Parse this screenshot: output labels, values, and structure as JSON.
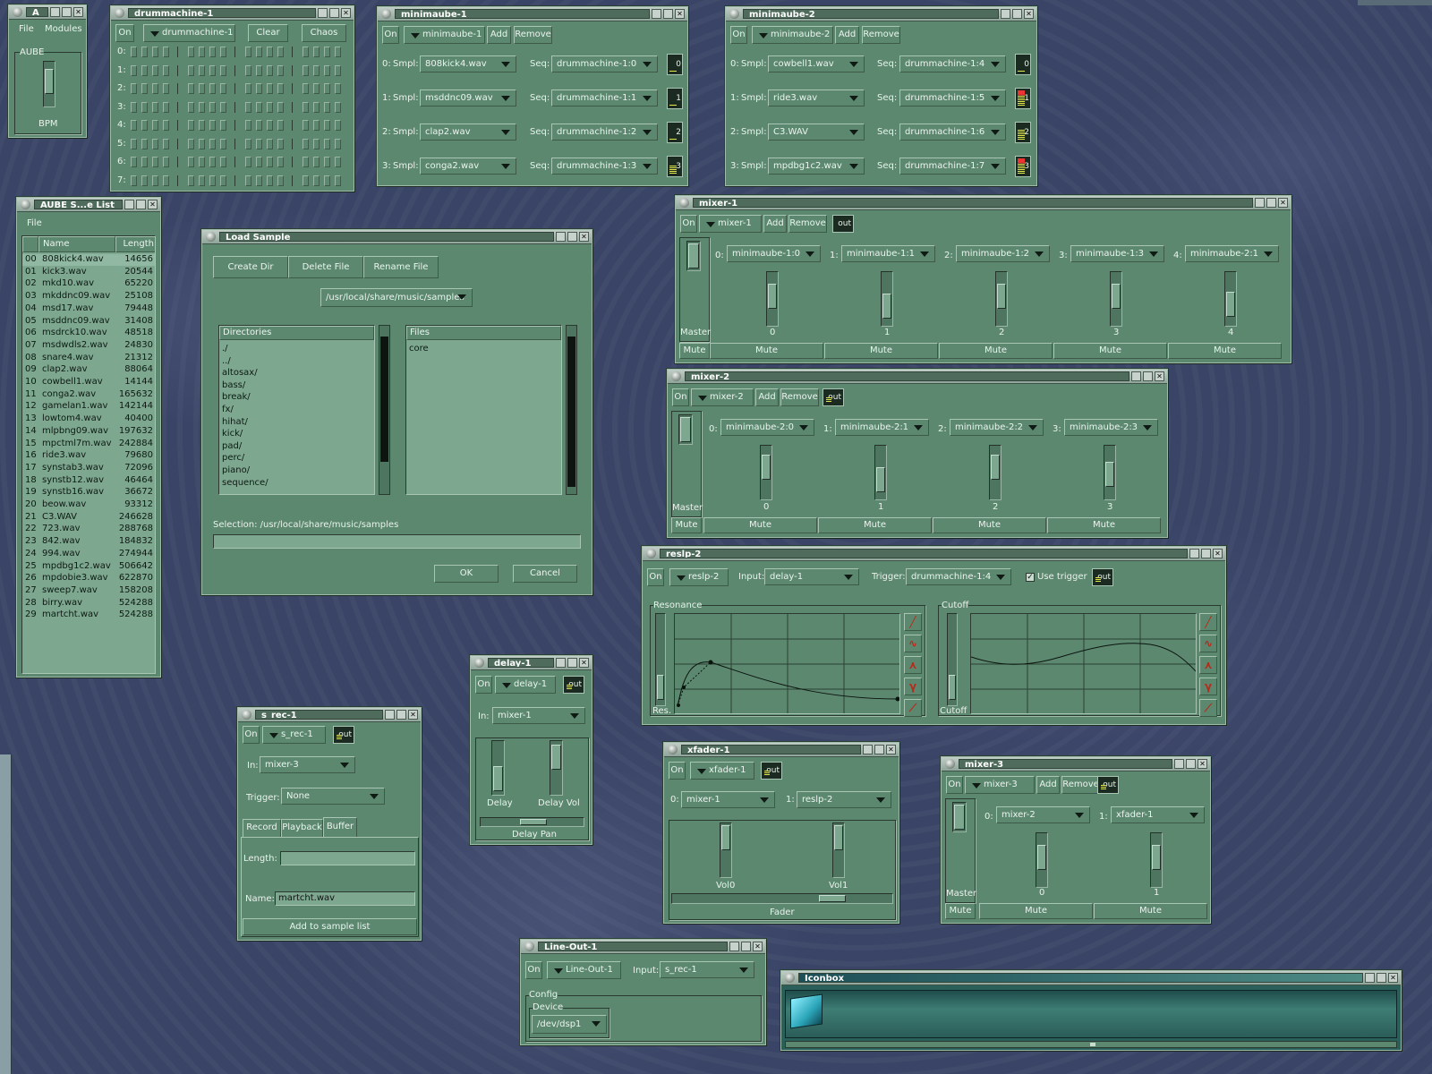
{
  "aube_main": {
    "title": "A",
    "menu_file": "File",
    "menu_modules": "Modules",
    "frame": "AUBE",
    "bpm": "BPM"
  },
  "drummachine": {
    "title": "drummachine-1",
    "on": "On",
    "module": "drummachine-1",
    "clear": "Clear",
    "chaos": "Chaos",
    "rows": [
      "0:",
      "1:",
      "2:",
      "3:",
      "4:",
      "5:",
      "6:",
      "7:"
    ]
  },
  "minimaube1": {
    "title": "minimaube-1",
    "on": "On",
    "module": "minimaube-1",
    "add": "Add",
    "remove": "Remove",
    "smpl": "Smpl:",
    "seq": "Seq:",
    "rows": [
      {
        "idx": "0:",
        "sample": "808kick4.wav",
        "seq": "drummachine-1:0",
        "meter": "0",
        "level": 0.1
      },
      {
        "idx": "1:",
        "sample": "msddnc09.wav",
        "seq": "drummachine-1:1",
        "meter": "1",
        "level": 0.1
      },
      {
        "idx": "2:",
        "sample": "clap2.wav",
        "seq": "drummachine-1:2",
        "meter": "2",
        "level": 0.1
      },
      {
        "idx": "3:",
        "sample": "conga2.wav",
        "seq": "drummachine-1:3",
        "meter": "3",
        "level": 0.5
      }
    ]
  },
  "minimaube2": {
    "title": "minimaube-2",
    "on": "On",
    "module": "minimaube-2",
    "add": "Add",
    "remove": "Remove",
    "smpl": "Smpl:",
    "seq": "Seq:",
    "rows": [
      {
        "idx": "0:",
        "sample": "cowbell1.wav",
        "seq": "drummachine-1:4",
        "meter": "0",
        "level": 0.1
      },
      {
        "idx": "1:",
        "sample": "ride3.wav",
        "seq": "drummachine-1:5",
        "meter": "1",
        "level": 0.9
      },
      {
        "idx": "2:",
        "sample": "C3.WAV",
        "seq": "drummachine-1:6",
        "meter": "2",
        "level": 0.6
      },
      {
        "idx": "3:",
        "sample": "mpdbg1c2.wav",
        "seq": "drummachine-1:7",
        "meter": "3",
        "level": 0.9
      }
    ]
  },
  "samplelist": {
    "title": "AUBE S...e List",
    "menu_file": "File",
    "col_name": "Name",
    "col_length": "Length",
    "rows": [
      [
        "00",
        "808kick4.wav",
        "14656"
      ],
      [
        "01",
        "kick3.wav",
        "20544"
      ],
      [
        "02",
        "mkd10.wav",
        "65220"
      ],
      [
        "03",
        "mkddnc09.wav",
        "25108"
      ],
      [
        "04",
        "msd17.wav",
        "79448"
      ],
      [
        "05",
        "msddnc09.wav",
        "31408"
      ],
      [
        "06",
        "msdrck10.wav",
        "48518"
      ],
      [
        "07",
        "msdwdls2.wav",
        "24830"
      ],
      [
        "08",
        "snare4.wav",
        "21312"
      ],
      [
        "09",
        "clap2.wav",
        "88064"
      ],
      [
        "10",
        "cowbell1.wav",
        "14144"
      ],
      [
        "11",
        "conga2.wav",
        "165632"
      ],
      [
        "12",
        "gamelan1.wav",
        "142144"
      ],
      [
        "13",
        "lowtom4.wav",
        "40400"
      ],
      [
        "14",
        "mlpbng09.wav",
        "197632"
      ],
      [
        "15",
        "mpctml7m.wav",
        "242884"
      ],
      [
        "16",
        "ride3.wav",
        "79680"
      ],
      [
        "17",
        "synstab3.wav",
        "72096"
      ],
      [
        "18",
        "synstb12.wav",
        "46464"
      ],
      [
        "19",
        "synstb16.wav",
        "36672"
      ],
      [
        "20",
        "beow.wav",
        "93312"
      ],
      [
        "21",
        "C3.WAV",
        "246628"
      ],
      [
        "22",
        "723.wav",
        "288768"
      ],
      [
        "23",
        "842.wav",
        "184832"
      ],
      [
        "24",
        "994.wav",
        "274944"
      ],
      [
        "25",
        "mpdbg1c2.wav",
        "506642"
      ],
      [
        "26",
        "mpdobie3.wav",
        "622870"
      ],
      [
        "27",
        "sweep7.wav",
        "158208"
      ],
      [
        "28",
        "birry.wav",
        "524288"
      ],
      [
        "29",
        "martcht.wav",
        "524288"
      ]
    ]
  },
  "loadsample": {
    "title": "Load Sample",
    "create_dir": "Create Dir",
    "delete_file": "Delete File",
    "rename_file": "Rename File",
    "path": "/usr/local/share/music/samples",
    "dirs_header": "Directories",
    "files_header": "Files",
    "dirs": [
      "./",
      "../",
      "altosax/",
      "bass/",
      "break/",
      "fx/",
      "hihat/",
      "kick/",
      "pad/",
      "perc/",
      "piano/",
      "sequence/"
    ],
    "files": [
      "core"
    ],
    "selection": "Selection: /usr/local/share/music/samples",
    "ok": "OK",
    "cancel": "Cancel"
  },
  "mixer1": {
    "title": "mixer-1",
    "on": "On",
    "module": "mixer-1",
    "add": "Add",
    "remove": "Remove",
    "out": "out",
    "master": "Master",
    "mute": "Mute",
    "channels": [
      {
        "idx": "0:",
        "src": "minimaube-1:0",
        "num": "0",
        "mute": "Mute",
        "level": 0.6
      },
      {
        "idx": "1:",
        "src": "minimaube-1:1",
        "num": "1",
        "mute": "Mute",
        "level": 0.25
      },
      {
        "idx": "2:",
        "src": "minimaube-1:2",
        "num": "2",
        "mute": "Mute",
        "level": 0.6
      },
      {
        "idx": "3:",
        "src": "minimaube-1:3",
        "num": "3",
        "mute": "Mute",
        "level": 0.6
      },
      {
        "idx": "4:",
        "src": "minimaube-2:1",
        "num": "4",
        "mute": "Mute",
        "level": 0.3
      }
    ]
  },
  "mixer2": {
    "title": "mixer-2",
    "on": "On",
    "module": "mixer-2",
    "add": "Add",
    "remove": "Remove",
    "out": "out",
    "master": "Master",
    "mute": "Mute",
    "channels": [
      {
        "idx": "0:",
        "src": "minimaube-2:0",
        "num": "0",
        "mute": "Mute",
        "level": 0.7
      },
      {
        "idx": "1:",
        "src": "minimaube-2:1",
        "num": "1",
        "mute": "Mute",
        "level": 0.25
      },
      {
        "idx": "2:",
        "src": "minimaube-2:2",
        "num": "2",
        "mute": "Mute",
        "level": 0.7
      },
      {
        "idx": "3:",
        "src": "minimaube-2:3",
        "num": "3",
        "mute": "Mute",
        "level": 0.45
      }
    ]
  },
  "reslp": {
    "title": "reslp-2",
    "on": "On",
    "module": "reslp-2",
    "input_label": "Input:",
    "input": "delay-1",
    "trigger_label": "Trigger:",
    "trigger": "drummachine-1:4",
    "use_trigger": "Use trigger",
    "out": "out",
    "resonance": "Resonance",
    "res": "Res.",
    "cutoff": "Cutoff",
    "cutoff_lbl": "Cutoff"
  },
  "delay": {
    "title": "delay-1",
    "on": "On",
    "module": "delay-1",
    "out": "out",
    "in_label": "In:",
    "input": "mixer-1",
    "delay": "Delay",
    "delay_vol": "Delay Vol",
    "delay_pan": "Delay Pan"
  },
  "srec": {
    "title": "s_rec-1",
    "on": "On",
    "module": "s_rec-1",
    "out": "out",
    "in_label": "In:",
    "input": "mixer-3",
    "trigger_label": "Trigger:",
    "trigger": "None",
    "tab_record": "Record",
    "tab_playback": "Playback",
    "tab_buffer": "Buffer",
    "length_label": "Length:",
    "length": "",
    "name_label": "Name:",
    "name": "martcht.wav",
    "add": "Add to sample list"
  },
  "xfader": {
    "title": "xfader-1",
    "on": "On",
    "module": "xfader-1",
    "out": "out",
    "in0_label": "0:",
    "in0": "mixer-1",
    "in1_label": "1:",
    "in1": "reslp-2",
    "vol0": "Vol0",
    "vol1": "Vol1",
    "fader": "Fader"
  },
  "mixer3": {
    "title": "mixer-3",
    "on": "On",
    "module": "mixer-3",
    "add": "Add",
    "remove": "Remove",
    "out": "out",
    "master": "Master",
    "mute": "Mute",
    "channels": [
      {
        "idx": "0:",
        "src": "mixer-2",
        "num": "0",
        "mute": "Mute",
        "level": 0.6
      },
      {
        "idx": "1:",
        "src": "xfader-1",
        "num": "1",
        "mute": "Mute",
        "level": 0.6
      }
    ]
  },
  "lineout": {
    "title": "Line-Out-1",
    "on": "On",
    "module": "Line-Out-1",
    "input_label": "Input:",
    "input": "s_rec-1",
    "config": "Config",
    "device_label": "Device",
    "device": "/dev/dsp1"
  },
  "iconbox": {
    "title": "Iconbox"
  }
}
